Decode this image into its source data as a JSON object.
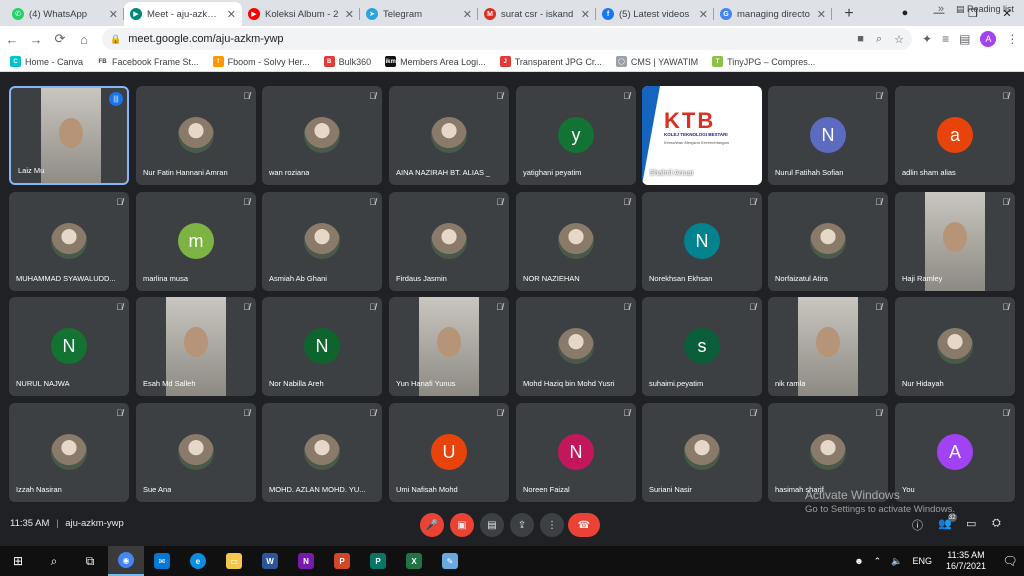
{
  "browser": {
    "tabs": [
      {
        "title": "(4) WhatsApp",
        "icon": "whatsapp-icon",
        "color": "#25d366",
        "glyph": "✆"
      },
      {
        "title": "Meet - aju-azkm-ywp",
        "icon": "meet-icon",
        "color": "#00897b",
        "glyph": "▶",
        "active": true
      },
      {
        "title": "Koleksi Album - 2",
        "icon": "youtube-icon",
        "color": "#ff0000",
        "glyph": "▶"
      },
      {
        "title": "Telegram",
        "icon": "telegram-icon",
        "color": "#2aa3df",
        "glyph": "➤"
      },
      {
        "title": "surat csr - iskand",
        "icon": "gmail-icon",
        "color": "#d93025",
        "glyph": "M"
      },
      {
        "title": "(5) Latest videos",
        "icon": "facebook-icon",
        "color": "#1877f2",
        "glyph": "f"
      },
      {
        "title": "managing directo",
        "icon": "google-icon",
        "color": "#4285f4",
        "glyph": "G"
      }
    ],
    "new_tab": "+",
    "url": "meet.google.com/aju-azkm-ywp",
    "profile_initial": "A",
    "bookmarks": [
      {
        "label": "Home - Canva",
        "icon": "canva-icon",
        "color": "#00c4cc",
        "glyph": "C"
      },
      {
        "label": "Facebook Frame St...",
        "icon": "fb-text-icon",
        "color": "#ffffff",
        "glyph": "FB",
        "textcolor": "#3c4043"
      },
      {
        "label": "Fboom - Solvy Her...",
        "icon": "fboom-icon",
        "color": "#ff9800",
        "glyph": "f"
      },
      {
        "label": "Bulk360",
        "icon": "bulk360-icon",
        "color": "#e53935",
        "glyph": "B"
      },
      {
        "label": "Members Area Logi...",
        "icon": "ikm-icon",
        "color": "#111111",
        "glyph": "ikm"
      },
      {
        "label": "Transparent JPG Cr...",
        "icon": "jpg-icon",
        "color": "#e53935",
        "glyph": "J"
      },
      {
        "label": "CMS | YAWATIM",
        "icon": "globe-icon",
        "color": "#9aa0a6",
        "glyph": "◯"
      },
      {
        "label": "TinyJPG – Compres...",
        "icon": "tinyjpg-icon",
        "color": "#8bc34a",
        "glyph": "T"
      }
    ],
    "bookmarks_more": "»",
    "reading_list": "Reading list"
  },
  "meet": {
    "participants": [
      {
        "name": "Laiz Mu",
        "type": "video",
        "speaking": true
      },
      {
        "name": "Nur Fatin Hannani Amran",
        "type": "photo"
      },
      {
        "name": "wan roziana",
        "type": "photo"
      },
      {
        "name": "AINA NAZIRAH BT. ALIAS _",
        "type": "photo"
      },
      {
        "name": "yatighani peyatim",
        "type": "initial",
        "initial": "y",
        "color": "#137333"
      },
      {
        "name": "Shahril Anuar",
        "type": "ktb"
      },
      {
        "name": "Nurul Fatihah Sofian",
        "type": "initial",
        "initial": "N",
        "color": "#5c6bc0"
      },
      {
        "name": "adlin sham alias",
        "type": "initial",
        "initial": "a",
        "color": "#e8430a"
      },
      {
        "name": "MUHAMMAD SYAWALUDD...",
        "type": "photo"
      },
      {
        "name": "marlina musa",
        "type": "initial",
        "initial": "m",
        "color": "#7cb342"
      },
      {
        "name": "Asmiah Ab Ghani",
        "type": "photo"
      },
      {
        "name": "Firdaus Jasmin",
        "type": "photo"
      },
      {
        "name": "NOR NAZIEHAN",
        "type": "photo"
      },
      {
        "name": "Norekhsan Ekhsan",
        "type": "initial",
        "initial": "N",
        "color": "#00838f"
      },
      {
        "name": "Norfaizatul Atira",
        "type": "photo"
      },
      {
        "name": "Haji Ramley",
        "type": "video"
      },
      {
        "name": "NURUL NAJWA",
        "type": "initial",
        "initial": "N",
        "color": "#137333"
      },
      {
        "name": "Esah Md Salleh",
        "type": "video"
      },
      {
        "name": "Nor Nabilla Areh",
        "type": "initial",
        "initial": "N",
        "color": "#0d652d"
      },
      {
        "name": "Yun Hanafi Yunus",
        "type": "video"
      },
      {
        "name": "Mohd Haziq bin Mohd Yusri",
        "type": "photo"
      },
      {
        "name": "suhaimi.peyatim",
        "type": "initial",
        "initial": "s",
        "color": "#0b5e3a"
      },
      {
        "name": "nik ramla",
        "type": "video"
      },
      {
        "name": "Nur Hidayah",
        "type": "photo"
      },
      {
        "name": "Izzah Nasiran",
        "type": "photo"
      },
      {
        "name": "Sue Ana",
        "type": "photo"
      },
      {
        "name": "MOHD. AZLAN MOHD. YU...",
        "type": "photo"
      },
      {
        "name": "Umi Nafisah Mohd",
        "type": "initial",
        "initial": "U",
        "color": "#e8430a"
      },
      {
        "name": "Noreen Faizal",
        "type": "initial",
        "initial": "N",
        "color": "#c2185b"
      },
      {
        "name": "Suriani Nasir",
        "type": "photo"
      },
      {
        "name": "hasimah sharif",
        "type": "photo"
      },
      {
        "name": "You",
        "type": "initial",
        "initial": "A",
        "color": "#a142f4"
      }
    ],
    "ktb_logo": "KTB",
    "ktb_sub": "KOLEJ TEKNOLOGI BESTARI",
    "ktb_sub2": "Kemahiran Menjana Kecemerlangan",
    "time": "11:35 AM",
    "separator": "|",
    "meeting_code": "aju-azkm-ywp",
    "participant_count": "32",
    "watermark_title": "Activate Windows",
    "watermark_text": "Go to Settings to activate Windows."
  },
  "taskbar": {
    "lang": "ENG",
    "clock_time": "11:35 AM",
    "clock_date": "16/7/2021"
  }
}
